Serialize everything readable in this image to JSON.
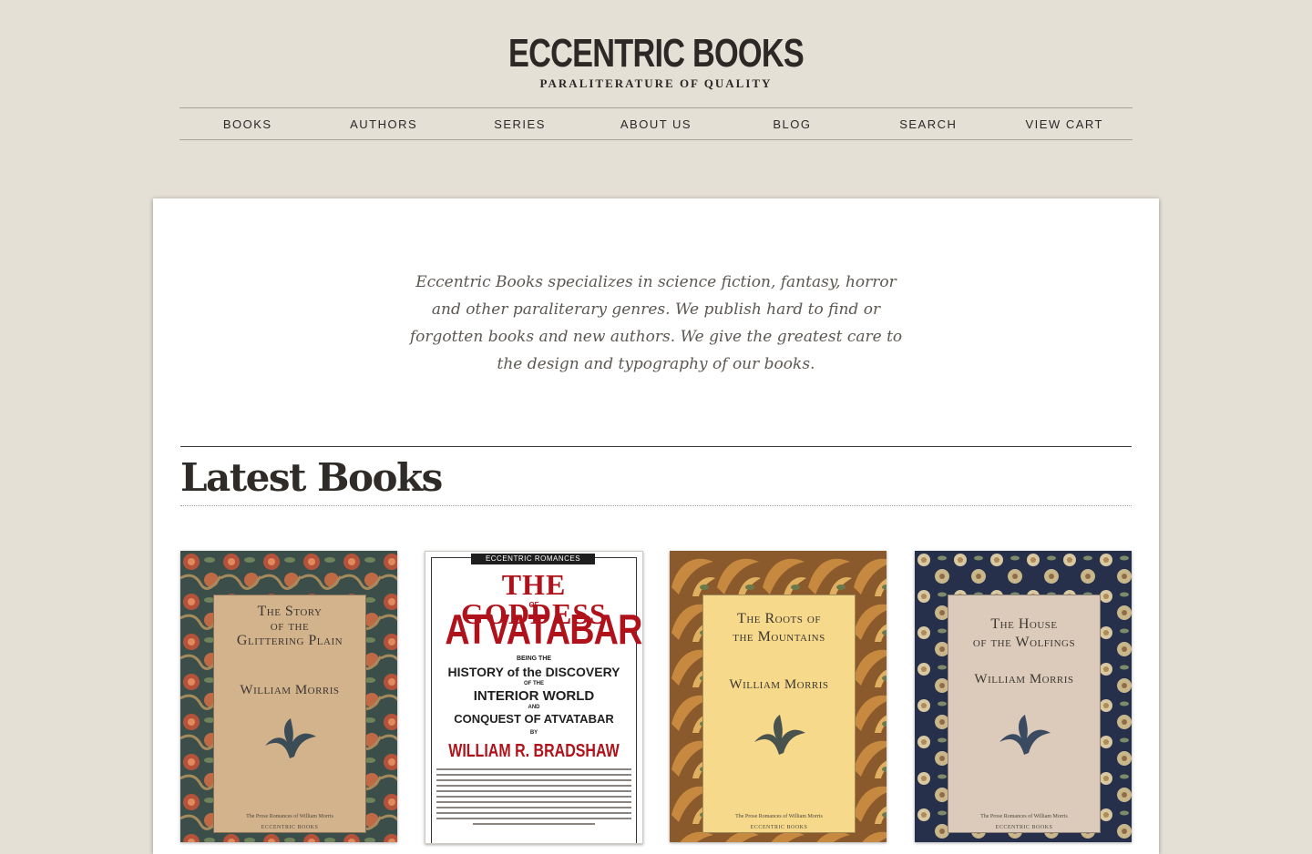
{
  "header": {
    "logo_title": "ECCENTRIC BOOKS",
    "logo_tagline": "PARALITERATURE OF QUALITY"
  },
  "nav": {
    "items": [
      {
        "label": "BOOKS"
      },
      {
        "label": "AUTHORS"
      },
      {
        "label": "SERIES"
      },
      {
        "label": "ABOUT US"
      },
      {
        "label": "BLOG"
      },
      {
        "label": "SEARCH"
      },
      {
        "label": "VIEW CART"
      }
    ]
  },
  "main": {
    "intro": "Eccentric Books specializes in science fiction, fantasy, horror and other paraliterary genres. We publish hard to find or forgotten books and new authors. We give the greatest care to the design and typography of our books.",
    "section_title": "Latest Books"
  },
  "books": [
    {
      "title_line1": "The Story",
      "title_line2": "of the",
      "title_line3": "Glittering Plain",
      "author": "William Morris",
      "series": "The Prose Romances of William Morris",
      "publisher": "ECCENTRIC BOOKS"
    },
    {
      "series": "ECCENTRIC ROMANCES",
      "title_line1": "THE GODDESS",
      "title_of": "OF",
      "title_line2": "ATVATABAR",
      "sub_being": "BEING THE",
      "sub_line1": "HISTORY of the DISCOVERY",
      "sub_of": "OF THE",
      "sub_line2": "INTERIOR WORLD",
      "sub_and": "AND",
      "sub_line3": "CONQUEST OF ATVATABAR",
      "sub_by": "BY",
      "author": "WILLIAM R. BRADSHAW"
    },
    {
      "title_line1": "The Roots of",
      "title_line2": "the Mountains",
      "author": "William Morris",
      "series": "The Prose Romances of William Morris",
      "publisher": "ECCENTRIC BOOKS"
    },
    {
      "title_line1": "The House",
      "title_line2": "of the Wolfings",
      "author": "William Morris",
      "series": "The Prose Romances of William Morris",
      "publisher": "ECCENTRIC BOOKS"
    }
  ],
  "colors": {
    "page_bg": "#e5e0d6",
    "card_bg": "#ffffff",
    "accent_red": "#b0121b"
  }
}
